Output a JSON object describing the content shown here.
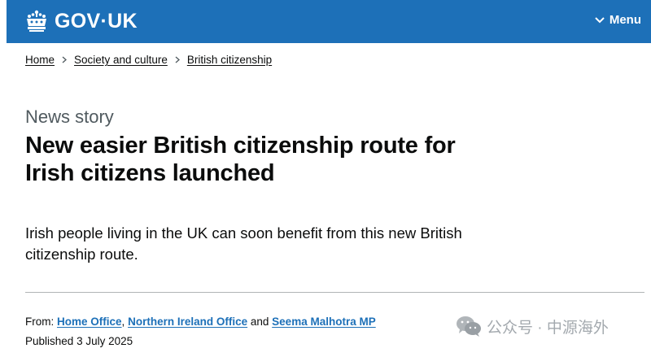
{
  "header": {
    "logo_text": "GOV·UK",
    "menu_label": "Menu",
    "colors": {
      "header_bg": "#1d70b8",
      "link": "#1d70b8"
    },
    "icons": {
      "logo": "crown-icon",
      "menu": "chevron-down-icon"
    }
  },
  "breadcrumbs": [
    {
      "label": "Home"
    },
    {
      "label": "Society and culture"
    },
    {
      "label": "British citizenship"
    }
  ],
  "article": {
    "caption": "News story",
    "title": "New easier British citizenship route for Irish citizens launched",
    "lede": "Irish people living in the UK can soon benefit from this new British citizenship route."
  },
  "metadata": {
    "from_label": "From:",
    "from_links": [
      "Home Office",
      "Northern Ireland Office",
      "Seema Malhotra MP"
    ],
    "sep_comma": ",",
    "sep_and": "and",
    "published_label": "Published",
    "published_date": "3 July 2025"
  },
  "watermark": {
    "text": "公众号 · 中源海外",
    "icon": "wechat-icon"
  }
}
